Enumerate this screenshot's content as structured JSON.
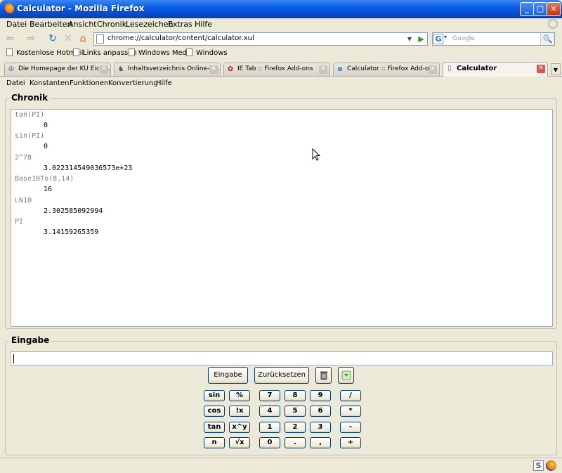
{
  "window": {
    "title": "Calculator - Mozilla Firefox",
    "min": "_",
    "max": "□",
    "close": "✕"
  },
  "menubar": [
    "Datei",
    "Bearbeiten",
    "Ansicht",
    "Chronik",
    "Lesezeichen",
    "Extras",
    "Hilfe"
  ],
  "navbar": {
    "back": "⇦",
    "forward": "⇨",
    "reload": "↻",
    "stop": "✕",
    "home": "⌂",
    "url": "chrome://calculator/content/calculator.xul",
    "url_dropdown": "▼",
    "go": "▶",
    "search_engine": "G",
    "search_engine_dropdown": "▾",
    "search_placeholder": "Google",
    "search_button": "🔍"
  },
  "bookmarks": [
    "Kostenlose Hotmail",
    "Links anpassen",
    "Windows Media",
    "Windows"
  ],
  "tabs": [
    {
      "label": "Die Homepage der KU Eich…",
      "icon": "♔"
    },
    {
      "label": "Inhaltsverzeichnis Online-V…",
      "icon": "♞"
    },
    {
      "label": "IE Tab :: Firefox Add-ons",
      "icon": "✿"
    },
    {
      "label": "Calculator :: Firefox Add-ons",
      "icon": "e"
    },
    {
      "label": "Calculator",
      "icon": "▯"
    }
  ],
  "tab_close": "✕",
  "tab_scroll": "▼",
  "app_menu": [
    "Datei",
    "Konstanten",
    "Funktionen",
    "Konvertierung",
    "Hilfe"
  ],
  "history": {
    "legend": "Chronik",
    "items": [
      {
        "expr": "tan(PI)",
        "result": "0"
      },
      {
        "expr": "sin(PI)",
        "result": "0"
      },
      {
        "expr": "2^78",
        "result": "3.022314549036573e+23"
      },
      {
        "expr": "Base10To(8,14)",
        "result": "16"
      },
      {
        "expr": "LN10",
        "result": "2.302585092994"
      },
      {
        "expr": "PI",
        "result": "3.14159265359"
      }
    ]
  },
  "input": {
    "legend": "Eingabe",
    "value": "",
    "enter_button": "Eingabe",
    "reset_button": "Zurücksetzen"
  },
  "keypad": {
    "functions": [
      "sin",
      "%",
      "cos",
      "!x",
      "tan",
      "x^y",
      "n",
      "√x"
    ],
    "digits": [
      "7",
      "8",
      "9",
      "4",
      "5",
      "6",
      "1",
      "2",
      "3",
      "0",
      ".",
      ","
    ],
    "operators": [
      "/",
      "*",
      "-",
      "+"
    ]
  },
  "status": {
    "s_icon": "S"
  }
}
